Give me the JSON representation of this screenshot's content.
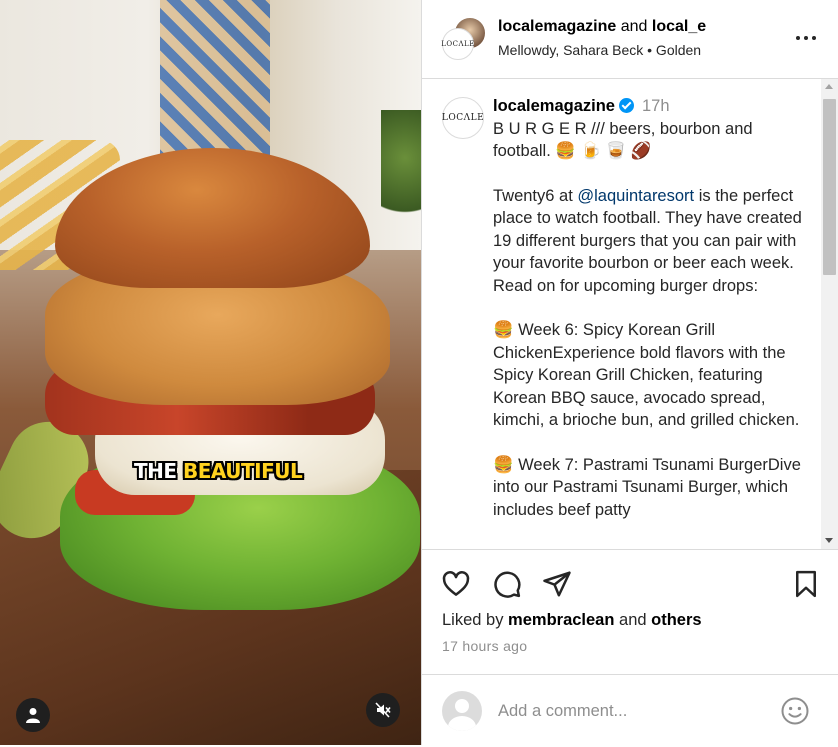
{
  "media": {
    "caption_white": "THE ",
    "caption_yellow": "BEAUTIFUL",
    "caption_highlight_color": "#ffd21f"
  },
  "header": {
    "user1": "localemagazine",
    "joiner": " and ",
    "user2": "local_e",
    "subtitle": "Mellowdy, Sahara Beck • Golden",
    "logo_text": "LOCΛLE"
  },
  "post": {
    "avatar_text": "LOCΛLE",
    "username": "localemagazine",
    "time": "17h",
    "caption_line1": "B U R G E R /// beers, bourbon and football. 🍔 🍺 🥃 🏈",
    "para2_before": "Twenty6 at ",
    "para2_mention": "@laquintaresort",
    "para2_after": " is the perfect place to watch football. They have created 19 different burgers that you can pair with your favorite bourbon or beer each week. Read on for upcoming burger drops:",
    "week6": "🍔 Week 6: Spicy Korean Grill ChickenExperience bold flavors with the Spicy Korean Grill Chicken, featuring Korean BBQ sauce, avocado spread, kimchi, a brioche bun, and grilled chicken.",
    "week7": "🍔 Week 7: Pastrami Tsunami BurgerDive into our Pastrami Tsunami Burger, which includes beef patty"
  },
  "actions": {
    "like_icon": "heart-icon",
    "comment_icon": "comment-icon",
    "share_icon": "share-icon",
    "save_icon": "bookmark-icon",
    "liked_prefix": "Liked by ",
    "liked_user": "membraclean",
    "liked_mid": " and ",
    "liked_others": "others",
    "time_ago": "17 hours ago"
  },
  "comment_box": {
    "placeholder": "Add a comment..."
  },
  "colors": {
    "accent_blue": "#0095f6",
    "mention": "#00376b",
    "secondary_text": "#8e8e8e",
    "border": "#dbdbdb"
  }
}
